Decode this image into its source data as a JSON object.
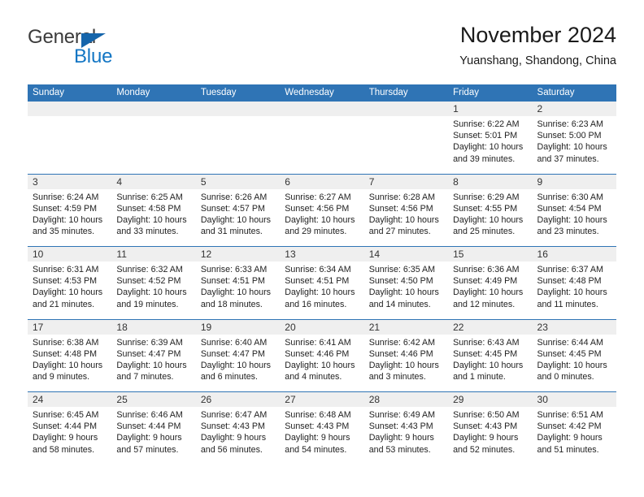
{
  "logo": {
    "word_top": "General",
    "word_bottom": "Blue",
    "triangle_color": "#1565ab",
    "blue_color": "#1376c4",
    "general_color": "#3b3b3b"
  },
  "header": {
    "title": "November 2024",
    "subtitle": "Yuanshang, Shandong, China"
  },
  "theme": {
    "header_blue": "#2f74b5",
    "daynum_band": "#efefef",
    "cell_bg": "#ffffff",
    "text": "#222222"
  },
  "weekdays": [
    "Sunday",
    "Monday",
    "Tuesday",
    "Wednesday",
    "Thursday",
    "Friday",
    "Saturday"
  ],
  "weeks": [
    [
      {
        "day": "",
        "sunrise": "",
        "sunset": "",
        "daylight": "",
        "empty": true
      },
      {
        "day": "",
        "sunrise": "",
        "sunset": "",
        "daylight": "",
        "empty": true
      },
      {
        "day": "",
        "sunrise": "",
        "sunset": "",
        "daylight": "",
        "empty": true
      },
      {
        "day": "",
        "sunrise": "",
        "sunset": "",
        "daylight": "",
        "empty": true
      },
      {
        "day": "",
        "sunrise": "",
        "sunset": "",
        "daylight": "",
        "empty": true
      },
      {
        "day": "1",
        "sunrise": "Sunrise: 6:22 AM",
        "sunset": "Sunset: 5:01 PM",
        "daylight": "Daylight: 10 hours and 39 minutes.",
        "empty": false
      },
      {
        "day": "2",
        "sunrise": "Sunrise: 6:23 AM",
        "sunset": "Sunset: 5:00 PM",
        "daylight": "Daylight: 10 hours and 37 minutes.",
        "empty": false
      }
    ],
    [
      {
        "day": "3",
        "sunrise": "Sunrise: 6:24 AM",
        "sunset": "Sunset: 4:59 PM",
        "daylight": "Daylight: 10 hours and 35 minutes.",
        "empty": false
      },
      {
        "day": "4",
        "sunrise": "Sunrise: 6:25 AM",
        "sunset": "Sunset: 4:58 PM",
        "daylight": "Daylight: 10 hours and 33 minutes.",
        "empty": false
      },
      {
        "day": "5",
        "sunrise": "Sunrise: 6:26 AM",
        "sunset": "Sunset: 4:57 PM",
        "daylight": "Daylight: 10 hours and 31 minutes.",
        "empty": false
      },
      {
        "day": "6",
        "sunrise": "Sunrise: 6:27 AM",
        "sunset": "Sunset: 4:56 PM",
        "daylight": "Daylight: 10 hours and 29 minutes.",
        "empty": false
      },
      {
        "day": "7",
        "sunrise": "Sunrise: 6:28 AM",
        "sunset": "Sunset: 4:56 PM",
        "daylight": "Daylight: 10 hours and 27 minutes.",
        "empty": false
      },
      {
        "day": "8",
        "sunrise": "Sunrise: 6:29 AM",
        "sunset": "Sunset: 4:55 PM",
        "daylight": "Daylight: 10 hours and 25 minutes.",
        "empty": false
      },
      {
        "day": "9",
        "sunrise": "Sunrise: 6:30 AM",
        "sunset": "Sunset: 4:54 PM",
        "daylight": "Daylight: 10 hours and 23 minutes.",
        "empty": false
      }
    ],
    [
      {
        "day": "10",
        "sunrise": "Sunrise: 6:31 AM",
        "sunset": "Sunset: 4:53 PM",
        "daylight": "Daylight: 10 hours and 21 minutes.",
        "empty": false
      },
      {
        "day": "11",
        "sunrise": "Sunrise: 6:32 AM",
        "sunset": "Sunset: 4:52 PM",
        "daylight": "Daylight: 10 hours and 19 minutes.",
        "empty": false
      },
      {
        "day": "12",
        "sunrise": "Sunrise: 6:33 AM",
        "sunset": "Sunset: 4:51 PM",
        "daylight": "Daylight: 10 hours and 18 minutes.",
        "empty": false
      },
      {
        "day": "13",
        "sunrise": "Sunrise: 6:34 AM",
        "sunset": "Sunset: 4:51 PM",
        "daylight": "Daylight: 10 hours and 16 minutes.",
        "empty": false
      },
      {
        "day": "14",
        "sunrise": "Sunrise: 6:35 AM",
        "sunset": "Sunset: 4:50 PM",
        "daylight": "Daylight: 10 hours and 14 minutes.",
        "empty": false
      },
      {
        "day": "15",
        "sunrise": "Sunrise: 6:36 AM",
        "sunset": "Sunset: 4:49 PM",
        "daylight": "Daylight: 10 hours and 12 minutes.",
        "empty": false
      },
      {
        "day": "16",
        "sunrise": "Sunrise: 6:37 AM",
        "sunset": "Sunset: 4:48 PM",
        "daylight": "Daylight: 10 hours and 11 minutes.",
        "empty": false
      }
    ],
    [
      {
        "day": "17",
        "sunrise": "Sunrise: 6:38 AM",
        "sunset": "Sunset: 4:48 PM",
        "daylight": "Daylight: 10 hours and 9 minutes.",
        "empty": false
      },
      {
        "day": "18",
        "sunrise": "Sunrise: 6:39 AM",
        "sunset": "Sunset: 4:47 PM",
        "daylight": "Daylight: 10 hours and 7 minutes.",
        "empty": false
      },
      {
        "day": "19",
        "sunrise": "Sunrise: 6:40 AM",
        "sunset": "Sunset: 4:47 PM",
        "daylight": "Daylight: 10 hours and 6 minutes.",
        "empty": false
      },
      {
        "day": "20",
        "sunrise": "Sunrise: 6:41 AM",
        "sunset": "Sunset: 4:46 PM",
        "daylight": "Daylight: 10 hours and 4 minutes.",
        "empty": false
      },
      {
        "day": "21",
        "sunrise": "Sunrise: 6:42 AM",
        "sunset": "Sunset: 4:46 PM",
        "daylight": "Daylight: 10 hours and 3 minutes.",
        "empty": false
      },
      {
        "day": "22",
        "sunrise": "Sunrise: 6:43 AM",
        "sunset": "Sunset: 4:45 PM",
        "daylight": "Daylight: 10 hours and 1 minute.",
        "empty": false
      },
      {
        "day": "23",
        "sunrise": "Sunrise: 6:44 AM",
        "sunset": "Sunset: 4:45 PM",
        "daylight": "Daylight: 10 hours and 0 minutes.",
        "empty": false
      }
    ],
    [
      {
        "day": "24",
        "sunrise": "Sunrise: 6:45 AM",
        "sunset": "Sunset: 4:44 PM",
        "daylight": "Daylight: 9 hours and 58 minutes.",
        "empty": false
      },
      {
        "day": "25",
        "sunrise": "Sunrise: 6:46 AM",
        "sunset": "Sunset: 4:44 PM",
        "daylight": "Daylight: 9 hours and 57 minutes.",
        "empty": false
      },
      {
        "day": "26",
        "sunrise": "Sunrise: 6:47 AM",
        "sunset": "Sunset: 4:43 PM",
        "daylight": "Daylight: 9 hours and 56 minutes.",
        "empty": false
      },
      {
        "day": "27",
        "sunrise": "Sunrise: 6:48 AM",
        "sunset": "Sunset: 4:43 PM",
        "daylight": "Daylight: 9 hours and 54 minutes.",
        "empty": false
      },
      {
        "day": "28",
        "sunrise": "Sunrise: 6:49 AM",
        "sunset": "Sunset: 4:43 PM",
        "daylight": "Daylight: 9 hours and 53 minutes.",
        "empty": false
      },
      {
        "day": "29",
        "sunrise": "Sunrise: 6:50 AM",
        "sunset": "Sunset: 4:43 PM",
        "daylight": "Daylight: 9 hours and 52 minutes.",
        "empty": false
      },
      {
        "day": "30",
        "sunrise": "Sunrise: 6:51 AM",
        "sunset": "Sunset: 4:42 PM",
        "daylight": "Daylight: 9 hours and 51 minutes.",
        "empty": false
      }
    ]
  ]
}
